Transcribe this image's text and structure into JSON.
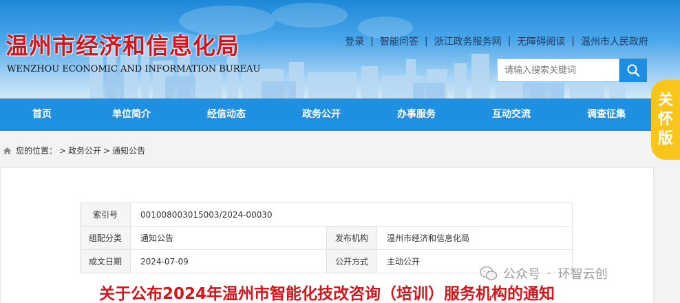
{
  "header": {
    "logo_cn": "温州市经济和信息化局",
    "logo_en": "WENZHOU ECONOMIC AND INFORMATION BUREAU",
    "top_links": [
      "登录",
      "智能问答",
      "浙江政务服务网",
      "无障碍阅读",
      "温州市人民政府"
    ],
    "search_placeholder": "请输入搜索关键词"
  },
  "care_button": [
    "关",
    "怀",
    "版"
  ],
  "nav": [
    "首页",
    "单位简介",
    "经信动态",
    "政务公开",
    "办事服务",
    "互动交流",
    "调查征集"
  ],
  "breadcrumb": {
    "label": "您的位置：",
    "items": [
      "政务公开",
      "通知公告"
    ]
  },
  "meta": {
    "row1": {
      "label": "索引号",
      "value": "001008003015003/2024-00030"
    },
    "row2": {
      "label": "组配分类",
      "value": "通知公告",
      "label2": "发布机构",
      "value2": "温州市经济和信息化局"
    },
    "row3": {
      "label": "成文日期",
      "value": "2024-07-09",
      "label2": "公开方式",
      "value2": "主动公开"
    }
  },
  "watermark": {
    "left": "公众号",
    "right": "环智云创"
  },
  "doc_title": "关于公布2024年温州市智能化技改咨询（培训）服务机构的通知",
  "colors": {
    "nav_bg": "#1f8fe2",
    "logo_red": "#d6141b",
    "title_red": "#d8141b",
    "care_yellow": "#f9c51a"
  }
}
